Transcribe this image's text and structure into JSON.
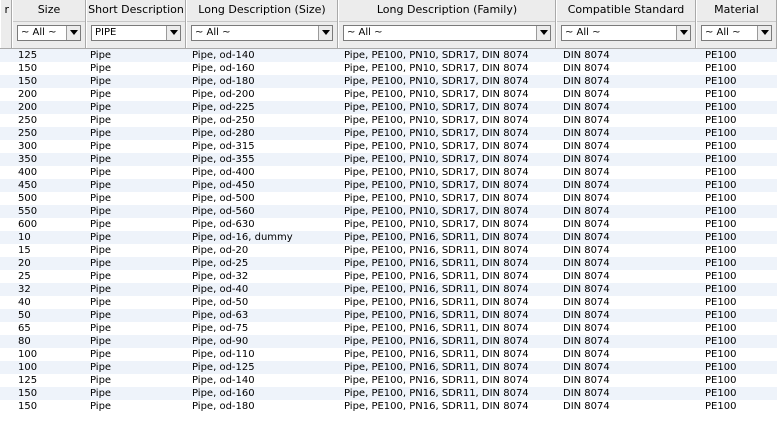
{
  "columns": [
    {
      "key": "prev",
      "title": "r",
      "filter": ""
    },
    {
      "key": "size",
      "title": "Size",
      "filter": "~ All ~"
    },
    {
      "key": "short",
      "title": "Short Description",
      "filter": "PIPE"
    },
    {
      "key": "longsize",
      "title": "Long Description (Size)",
      "filter": "~ All ~"
    },
    {
      "key": "longfam",
      "title": "Long Description (Family)",
      "filter": "~ All ~"
    },
    {
      "key": "std",
      "title": "Compatible Standard",
      "filter": "~ All ~"
    },
    {
      "key": "mat",
      "title": "Material",
      "filter": "~ All ~"
    }
  ],
  "rows": [
    [
      "125",
      "Pipe",
      "Pipe, od-140",
      "Pipe, PE100, PN10, SDR17, DIN 8074",
      "DIN 8074",
      "PE100"
    ],
    [
      "150",
      "Pipe",
      "Pipe, od-160",
      "Pipe, PE100, PN10, SDR17, DIN 8074",
      "DIN 8074",
      "PE100"
    ],
    [
      "150",
      "Pipe",
      "Pipe, od-180",
      "Pipe, PE100, PN10, SDR17, DIN 8074",
      "DIN 8074",
      "PE100"
    ],
    [
      "200",
      "Pipe",
      "Pipe, od-200",
      "Pipe, PE100, PN10, SDR17, DIN 8074",
      "DIN 8074",
      "PE100"
    ],
    [
      "200",
      "Pipe",
      "Pipe, od-225",
      "Pipe, PE100, PN10, SDR17, DIN 8074",
      "DIN 8074",
      "PE100"
    ],
    [
      "250",
      "Pipe",
      "Pipe, od-250",
      "Pipe, PE100, PN10, SDR17, DIN 8074",
      "DIN 8074",
      "PE100"
    ],
    [
      "250",
      "Pipe",
      "Pipe, od-280",
      "Pipe, PE100, PN10, SDR17, DIN 8074",
      "DIN 8074",
      "PE100"
    ],
    [
      "300",
      "Pipe",
      "Pipe, od-315",
      "Pipe, PE100, PN10, SDR17, DIN 8074",
      "DIN 8074",
      "PE100"
    ],
    [
      "350",
      "Pipe",
      "Pipe, od-355",
      "Pipe, PE100, PN10, SDR17, DIN 8074",
      "DIN 8074",
      "PE100"
    ],
    [
      "400",
      "Pipe",
      "Pipe, od-400",
      "Pipe, PE100, PN10, SDR17, DIN 8074",
      "DIN 8074",
      "PE100"
    ],
    [
      "450",
      "Pipe",
      "Pipe, od-450",
      "Pipe, PE100, PN10, SDR17, DIN 8074",
      "DIN 8074",
      "PE100"
    ],
    [
      "500",
      "Pipe",
      "Pipe, od-500",
      "Pipe, PE100, PN10, SDR17, DIN 8074",
      "DIN 8074",
      "PE100"
    ],
    [
      "550",
      "Pipe",
      "Pipe, od-560",
      "Pipe, PE100, PN10, SDR17, DIN 8074",
      "DIN 8074",
      "PE100"
    ],
    [
      "600",
      "Pipe",
      "Pipe, od-630",
      "Pipe, PE100, PN10, SDR17, DIN 8074",
      "DIN 8074",
      "PE100"
    ],
    [
      "10",
      "Pipe",
      "Pipe, od-16, dummy",
      "Pipe, PE100, PN16, SDR11, DIN 8074",
      "DIN 8074",
      "PE100"
    ],
    [
      "15",
      "Pipe",
      "Pipe, od-20",
      "Pipe, PE100, PN16, SDR11, DIN 8074",
      "DIN 8074",
      "PE100"
    ],
    [
      "20",
      "Pipe",
      "Pipe, od-25",
      "Pipe, PE100, PN16, SDR11, DIN 8074",
      "DIN 8074",
      "PE100"
    ],
    [
      "25",
      "Pipe",
      "Pipe, od-32",
      "Pipe, PE100, PN16, SDR11, DIN 8074",
      "DIN 8074",
      "PE100"
    ],
    [
      "32",
      "Pipe",
      "Pipe, od-40",
      "Pipe, PE100, PN16, SDR11, DIN 8074",
      "DIN 8074",
      "PE100"
    ],
    [
      "40",
      "Pipe",
      "Pipe, od-50",
      "Pipe, PE100, PN16, SDR11, DIN 8074",
      "DIN 8074",
      "PE100"
    ],
    [
      "50",
      "Pipe",
      "Pipe, od-63",
      "Pipe, PE100, PN16, SDR11, DIN 8074",
      "DIN 8074",
      "PE100"
    ],
    [
      "65",
      "Pipe",
      "Pipe, od-75",
      "Pipe, PE100, PN16, SDR11, DIN 8074",
      "DIN 8074",
      "PE100"
    ],
    [
      "80",
      "Pipe",
      "Pipe, od-90",
      "Pipe, PE100, PN16, SDR11, DIN 8074",
      "DIN 8074",
      "PE100"
    ],
    [
      "100",
      "Pipe",
      "Pipe, od-110",
      "Pipe, PE100, PN16, SDR11, DIN 8074",
      "DIN 8074",
      "PE100"
    ],
    [
      "100",
      "Pipe",
      "Pipe, od-125",
      "Pipe, PE100, PN16, SDR11, DIN 8074",
      "DIN 8074",
      "PE100"
    ],
    [
      "125",
      "Pipe",
      "Pipe, od-140",
      "Pipe, PE100, PN16, SDR11, DIN 8074",
      "DIN 8074",
      "PE100"
    ],
    [
      "150",
      "Pipe",
      "Pipe, od-160",
      "Pipe, PE100, PN16, SDR11, DIN 8074",
      "DIN 8074",
      "PE100"
    ],
    [
      "150",
      "Pipe",
      "Pipe, od-180",
      "Pipe, PE100, PN16, SDR11, DIN 8074",
      "DIN 8074",
      "PE100"
    ]
  ]
}
